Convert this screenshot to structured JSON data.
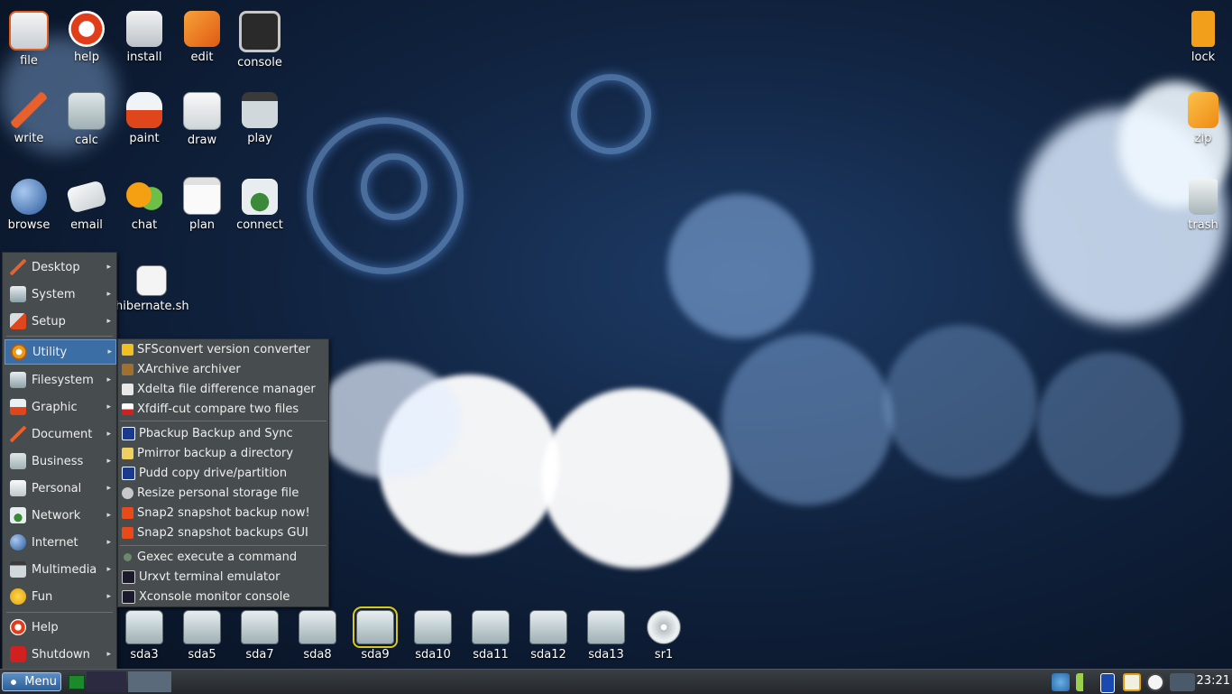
{
  "desktop_icons": {
    "file": "file",
    "help": "help",
    "install": "install",
    "edit": "edit",
    "console": "console",
    "write": "write",
    "calc": "calc",
    "paint": "paint",
    "draw": "draw",
    "play": "play",
    "browse": "browse",
    "email": "email",
    "chat": "chat",
    "plan": "plan",
    "connect": "connect",
    "hibernate": "hibernate.sh",
    "lock": "lock",
    "zip": "zip",
    "trash": "trash"
  },
  "menu": {
    "items": [
      {
        "label": "Desktop"
      },
      {
        "label": "System"
      },
      {
        "label": "Setup"
      },
      {
        "label": "Utility"
      },
      {
        "label": "Filesystem"
      },
      {
        "label": "Graphic"
      },
      {
        "label": "Document"
      },
      {
        "label": "Business"
      },
      {
        "label": "Personal"
      },
      {
        "label": "Network"
      },
      {
        "label": "Internet"
      },
      {
        "label": "Multimedia"
      },
      {
        "label": "Fun"
      },
      {
        "label": "Help"
      },
      {
        "label": "Shutdown"
      }
    ],
    "arrow": "▸"
  },
  "submenu": {
    "items": [
      {
        "label": "SFSconvert version converter"
      },
      {
        "label": "XArchive archiver"
      },
      {
        "label": "Xdelta file difference manager"
      },
      {
        "label": "Xfdiff-cut compare two files"
      },
      {
        "label": "Pbackup Backup and Sync"
      },
      {
        "label": "Pmirror backup a directory"
      },
      {
        "label": "Pudd copy drive/partition"
      },
      {
        "label": "Resize personal storage file"
      },
      {
        "label": "Snap2 snapshot backup now!"
      },
      {
        "label": "Snap2 snapshot backups GUI"
      },
      {
        "label": "Gexec execute a command"
      },
      {
        "label": "Urxvt terminal emulator"
      },
      {
        "label": "Xconsole monitor console"
      }
    ]
  },
  "drives": [
    "sda3",
    "sda5",
    "sda7",
    "sda8",
    "sda9",
    "sda10",
    "sda11",
    "sda12",
    "sda13",
    "sr1"
  ],
  "taskbar": {
    "menu_label": "Menu",
    "clock": "23:21"
  }
}
